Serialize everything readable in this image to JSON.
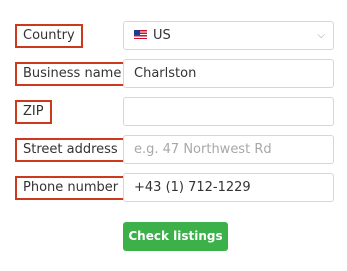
{
  "form": {
    "fields": [
      {
        "label": "Country",
        "value": "US",
        "type": "select",
        "icon": "us-flag-icon"
      },
      {
        "label": "Business name",
        "value": "Charlston",
        "type": "text"
      },
      {
        "label": "ZIP",
        "value": "",
        "type": "text"
      },
      {
        "label": "Street address",
        "value": "",
        "placeholder": "e.g. 47 Northwest Rd",
        "type": "text"
      },
      {
        "label": "Phone number",
        "value": "+43 (1) 712-1229",
        "type": "text"
      }
    ],
    "submit_label": "Check listings"
  },
  "colors": {
    "label_border": "#cc3a1e",
    "button_bg": "#3cb14a",
    "button_text": "#ffffff",
    "input_border": "#d6d6d6",
    "placeholder": "#a8a8a8"
  }
}
